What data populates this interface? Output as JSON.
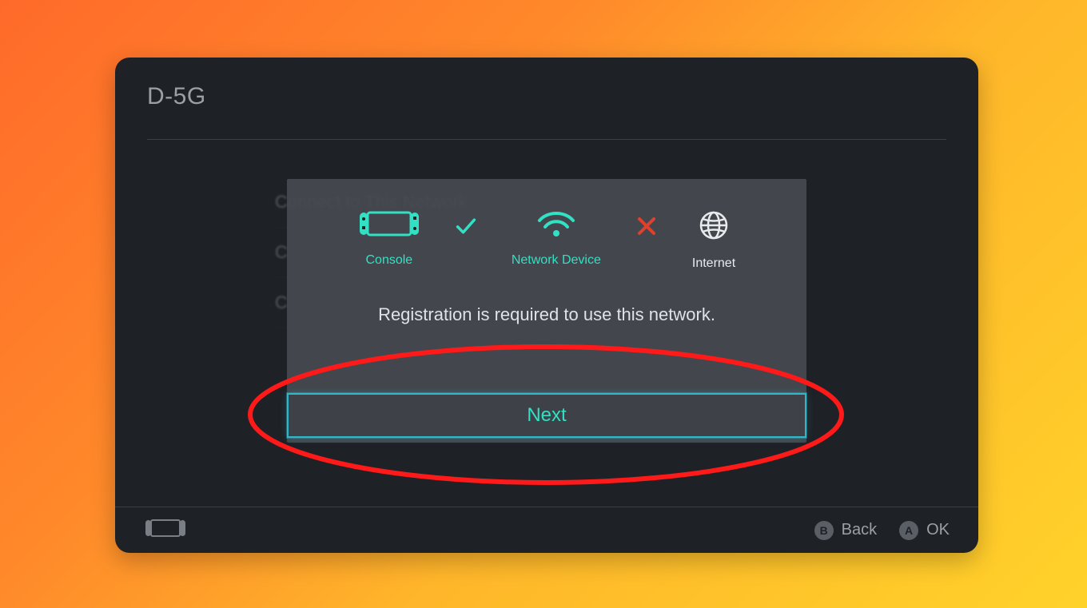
{
  "header": {
    "title": "D-5G"
  },
  "background_menu": {
    "items": [
      {
        "label": "Connect to This Network"
      },
      {
        "label": "C"
      },
      {
        "label": "C"
      }
    ]
  },
  "modal": {
    "status": {
      "console_label": "Console",
      "network_device_label": "Network Device",
      "internet_label": "Internet",
      "console_to_network": "ok",
      "network_to_internet": "fail"
    },
    "message": "Registration is required to use this network.",
    "next_label": "Next"
  },
  "footer": {
    "back_label": "Back",
    "ok_label": "OK",
    "back_button_glyph": "B",
    "ok_button_glyph": "A"
  },
  "colors": {
    "accent": "#32e0c4",
    "error": "#e0402c",
    "panel": "#1e2126"
  }
}
